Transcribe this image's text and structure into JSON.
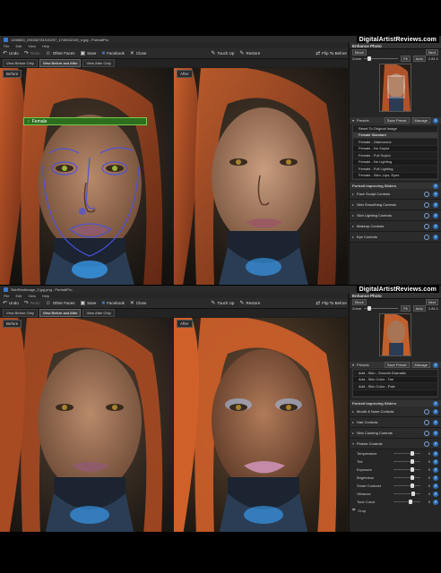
{
  "watermark": "DigitalArtistReviews.com",
  "pane1": {
    "window_title": "1498800_194552781919297_1740032149_n.jpg - PortraitPro",
    "menu": [
      "File",
      "Edit",
      "View",
      "Help"
    ],
    "toolbar": {
      "undo": "Undo",
      "redo": "Redo",
      "other_faces": "Other Faces",
      "save": "Save",
      "facebook": "Facebook",
      "close": "Close",
      "touch_up": "Touch Up",
      "restore": "Restore",
      "flip": "Flip To Before"
    },
    "view_buttons": [
      "View Before Only",
      "View Before and After",
      "View After Only"
    ],
    "before_label": "Before",
    "after_label": "After",
    "gender_label": "Female",
    "sidebar": {
      "header": "Enhance Photo",
      "block_btn": "Block",
      "next_btn": "Next",
      "zoom_label": "Zoom",
      "fit_btn": "Fit",
      "auto_btn": "Auto",
      "zoom_value": "2.81:1",
      "presets_label": "Presets",
      "save_preset": "Save Preset",
      "manage": "Manage",
      "presets": [
        "Reset To Original Image",
        "Female Standard",
        "Female - Glamorous",
        "Female - No Soylut",
        "Female - Full Soylut",
        "Female - No Lighting",
        "Female - Full Lighting",
        "Female - Skin, Lips, Eyes"
      ],
      "sliders_header": "Portrait Improving Sliders",
      "controls": [
        "Face Sculpt Controls",
        "Skin Smoothing Controls",
        "Skin Lighting Controls",
        "Makeup Controls",
        "Eye Controls"
      ]
    }
  },
  "pane2": {
    "window_title": "SkinRestImage_2.jpg.png - PortraitPro",
    "menu": [
      "File",
      "Edit",
      "View",
      "Help"
    ],
    "toolbar": {
      "undo": "Undo",
      "redo": "Redo",
      "other_faces": "Other Faces",
      "save": "Save",
      "facebook": "Facebook",
      "close": "Close",
      "touch_up": "Touch Up",
      "restore": "Restore",
      "flip": "Flip To Before"
    },
    "view_buttons": [
      "View Before Only",
      "View Before and After",
      "View After Only"
    ],
    "before_label": "Before",
    "after_label": "After",
    "sidebar": {
      "header": "Enhance Photo",
      "block_btn": "Block",
      "next_btn": "Next",
      "zoom_label": "Zoom",
      "fit_btn": "Fit",
      "auto_btn": "Auto",
      "zoom_value": "2.81:1",
      "presets_label": "Presets",
      "save_preset": "Save Preset",
      "manage": "Manage",
      "presets": [
        "Add - Skin - Smooth Dramatic",
        "Add - Skin Color - Tan",
        "Add - Skin Color - Pale",
        ""
      ],
      "sliders_header": "Portrait Improving Sliders",
      "controls": [
        "Mouth & Nose Controls",
        "Hair Controls",
        "Skin Coloring Controls",
        "Picture Controls"
      ],
      "picture_sliders": [
        {
          "label": "Temperature",
          "value": "0",
          "pos": 0.62
        },
        {
          "label": "Tint",
          "value": "0",
          "pos": 0.62
        },
        {
          "label": "Exposure",
          "value": "0",
          "pos": 0.62
        },
        {
          "label": "Brightness",
          "value": "0",
          "pos": 0.62
        },
        {
          "label": "Smart Contrast",
          "value": "0",
          "pos": 0.62
        },
        {
          "label": "Vibrance",
          "value": "4",
          "pos": 0.65
        },
        {
          "label": "Tone Curve",
          "value": "0",
          "pos": 0.55
        }
      ],
      "crop_label": "Crop"
    }
  }
}
